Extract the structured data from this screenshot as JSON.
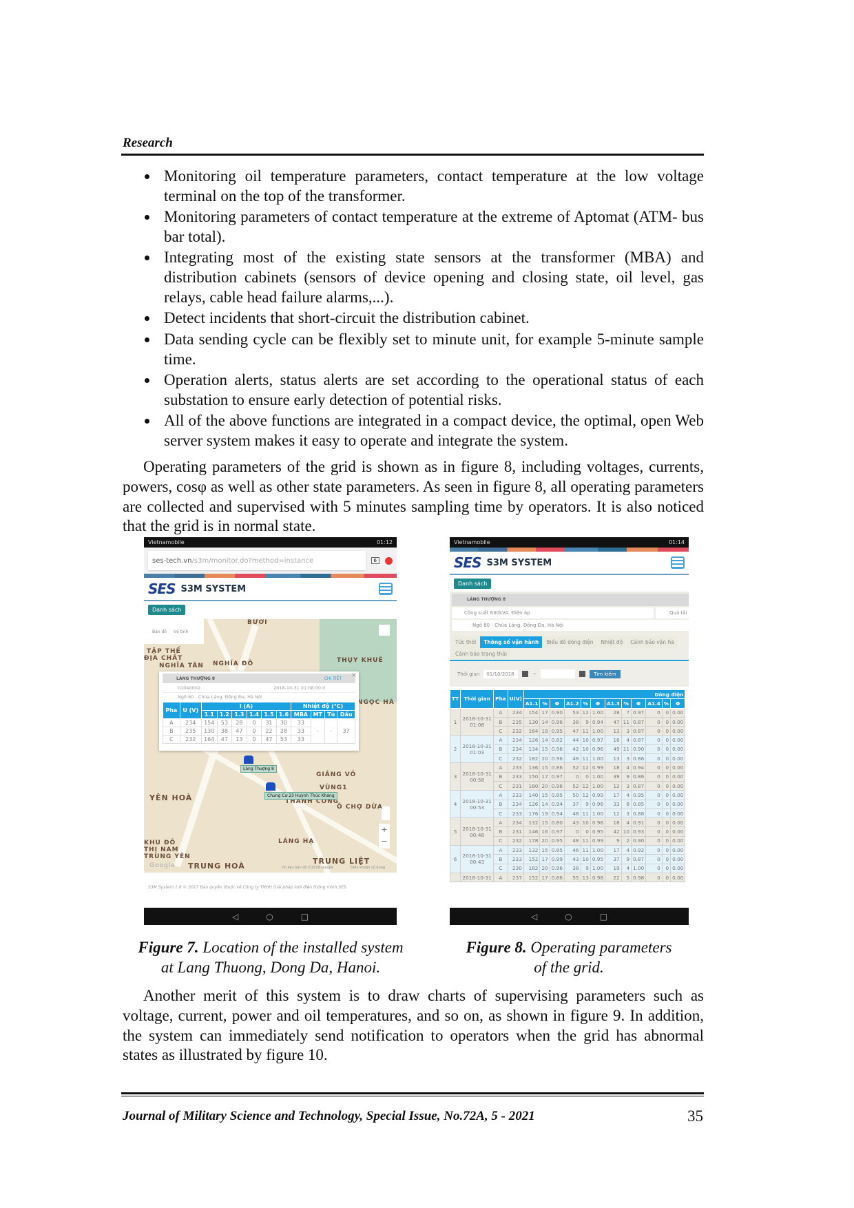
{
  "header": {
    "section": "Research"
  },
  "bullets": [
    "Monitoring oil temperature parameters, contact temperature at the low voltage terminal on the top of the transformer.",
    "Monitoring parameters of contact temperature at the extreme of Aptomat (ATM- bus bar total).",
    "Integrating most of the existing state sensors at the transformer (MBA) and distribution cabinets (sensors of device opening and closing state, oil level, gas relays, cable head failure alarms,...).",
    "Detect incidents that short-circuit the distribution cabinet.",
    "Data sending cycle can be flexibly set to minute unit, for example 5-minute sample time.",
    "Operation alerts, status alerts are set according to the operational status of each substation to ensure early detection of potential risks.",
    "All of the above functions are integrated in a compact device, the optimal, open Web server system makes it easy to operate and integrate the system."
  ],
  "para1": "Operating parameters of the grid is shown as in figure 8, including voltages, currents, powers, cosφ as well as other state parameters. As seen in figure 8, all operating parameters are collected and supervised with 5 minutes sampling time by operators. It is also noticed that the grid is in normal state.",
  "fig7": {
    "carrier": "Vietnamobile",
    "time": "01:12",
    "url_host": "ses-tech.vn",
    "url_path": "/s3m/monitor.do?method=instance",
    "tab_count": "6",
    "logo": "SES",
    "system": "S3M SYSTEM",
    "list_button": "Danh sách",
    "map_type": [
      "Bản đồ",
      "Vệ tinh"
    ],
    "map_labels": [
      "BƯỞI",
      "TẬP THỂ",
      "ĐỊA CHẤT",
      "NGHĨA TÂN",
      "NGHĨA ĐÔ",
      "THỤY KHUÊ",
      "NGỌC HÀ",
      "GIẢNG VÕ",
      "VÙNG1",
      "YÊN HOÀ",
      "THÀNH CÔNG",
      "Ô CHỢ DỪA",
      "LÁNG HẠ",
      "KHU ĐÔ",
      "THỊ NAM",
      "TRUNG YÊN",
      "TRUNG HOÀ",
      "TRUNG LIỆT",
      "Google",
      "Dữ liệu bản đồ ©2018 Google",
      "Điều khoản sử dụng"
    ],
    "markers": [
      "Láng Thượng 8",
      "Chung Cư 23 Huỳnh Thúc Kháng"
    ],
    "popup": {
      "station": "LÁNG THƯỢNG 8",
      "detail": "CHI TIẾT",
      "close": "×",
      "id": "01040002",
      "timestamp": "2018-10-31 01:08:00.0",
      "address": "Ngõ 80 - Chùa Láng, Đống Đa, Hà Nội",
      "headers": {
        "phase": "Pha",
        "voltage": "U (V)",
        "current": "I (A)",
        "temp": "Nhiệt độ (°C)"
      },
      "current_cols": [
        "1.1",
        "1.2",
        "1.3",
        "1.4",
        "1.5",
        "1.6"
      ],
      "temp_cols": [
        "MBA",
        "MT",
        "Tủ",
        "Dầu"
      ],
      "rows": [
        {
          "pha": "A",
          "u": "234",
          "i": [
            "154",
            "53",
            "28",
            "0",
            "31",
            "30"
          ],
          "mba": "33"
        },
        {
          "pha": "B",
          "u": "235",
          "i": [
            "130",
            "38",
            "47",
            "0",
            "22",
            "28"
          ],
          "mba": "33"
        },
        {
          "pha": "C",
          "u": "232",
          "i": [
            "164",
            "47",
            "13",
            "0",
            "47",
            "53"
          ],
          "mba": "33"
        }
      ],
      "mt": "-",
      "tu": "-",
      "dau": "37"
    },
    "copyright": "S3M System 1.0 © 2017 Bản quyền thuộc về Công ty TNHH Giải pháp lưới điện thông minh SES."
  },
  "fig8": {
    "carrier": "Vietnamobile",
    "time": "01:14",
    "logo": "SES",
    "system": "S3M SYSTEM",
    "list_button": "Danh sách",
    "station": "LÁNG THƯỢNG 8",
    "capacity": "Công suất 630kVA. Điện áp",
    "alert": "Quá tải",
    "address": "Ngõ 80 - Chùa Láng, Đống Đa, Hà Nội",
    "tabs": [
      "Tức thời",
      "Thông số vận hành",
      "Biểu đồ dòng điện",
      "Nhiệt độ",
      "Cảnh báo vận hà",
      "Cảnh báo trạng thái"
    ],
    "active_tab": 1,
    "time_label": "Thời gian",
    "date_from": "01/10/2018",
    "search": "Tìm kiếm",
    "headers": [
      "TT",
      "Thời gian",
      "Pha",
      "U(V)"
    ],
    "group_header": "Dòng điện",
    "sub_headers": [
      "A1.1",
      "%",
      "Φ",
      "A1.2",
      "%",
      "Φ",
      "A1.3",
      "%",
      "Φ",
      "A1.4",
      "%",
      "Φ"
    ],
    "groups": [
      {
        "tt": "1",
        "time": "2018-10-31 01:08",
        "rows": [
          [
            "A",
            "234",
            "154",
            "17",
            "0.90",
            "53",
            "12",
            "1.00",
            "28",
            "7",
            "0.97",
            "0",
            "0",
            "0.00"
          ],
          [
            "B",
            "235",
            "130",
            "14",
            "0.96",
            "38",
            "9",
            "0.94",
            "47",
            "11",
            "0.87",
            "0",
            "0",
            "0.00"
          ],
          [
            "C",
            "232",
            "164",
            "18",
            "0.95",
            "47",
            "11",
            "1.00",
            "13",
            "3",
            "0.87",
            "0",
            "0",
            "0.00"
          ]
        ]
      },
      {
        "tt": "2",
        "time": "2018-10-31 01:03",
        "rows": [
          [
            "A",
            "234",
            "126",
            "14",
            "0.82",
            "44",
            "10",
            "0.97",
            "16",
            "4",
            "0.87",
            "0",
            "0",
            "0.00"
          ],
          [
            "B",
            "234",
            "134",
            "15",
            "0.96",
            "42",
            "10",
            "0.96",
            "49",
            "11",
            "0.90",
            "0",
            "0",
            "0.00"
          ],
          [
            "C",
            "232",
            "182",
            "20",
            "0.96",
            "48",
            "11",
            "1.00",
            "13",
            "3",
            "0.86",
            "0",
            "0",
            "0.00"
          ]
        ]
      },
      {
        "tt": "3",
        "time": "2018-10-31 00:58",
        "rows": [
          [
            "A",
            "233",
            "136",
            "15",
            "0.86",
            "52",
            "12",
            "0.99",
            "18",
            "4",
            "0.94",
            "0",
            "0",
            "0.00"
          ],
          [
            "B",
            "233",
            "150",
            "17",
            "0.97",
            "0",
            "0",
            "1.00",
            "39",
            "9",
            "0.86",
            "0",
            "0",
            "0.00"
          ],
          [
            "C",
            "231",
            "180",
            "20",
            "0.96",
            "52",
            "12",
            "1.00",
            "12",
            "3",
            "0.87",
            "0",
            "0",
            "0.00"
          ]
        ]
      },
      {
        "tt": "4",
        "time": "2018-10-31 00:53",
        "rows": [
          [
            "A",
            "233",
            "140",
            "15",
            "0.85",
            "50",
            "12",
            "0.99",
            "17",
            "4",
            "0.95",
            "0",
            "0",
            "0.00"
          ],
          [
            "B",
            "234",
            "126",
            "14",
            "0.94",
            "37",
            "9",
            "0.96",
            "33",
            "8",
            "0.85",
            "0",
            "0",
            "0.00"
          ],
          [
            "C",
            "233",
            "176",
            "19",
            "0.94",
            "48",
            "11",
            "1.00",
            "12",
            "3",
            "0.88",
            "0",
            "0",
            "0.00"
          ]
        ]
      },
      {
        "tt": "5",
        "time": "2018-10-31 00:48",
        "rows": [
          [
            "A",
            "234",
            "132",
            "15",
            "0.80",
            "43",
            "10",
            "0.96",
            "18",
            "4",
            "0.91",
            "0",
            "0",
            "0.00"
          ],
          [
            "B",
            "231",
            "146",
            "16",
            "0.97",
            "0",
            "0",
            "0.95",
            "42",
            "10",
            "0.93",
            "0",
            "0",
            "0.00"
          ],
          [
            "C",
            "232",
            "178",
            "20",
            "0.95",
            "48",
            "11",
            "0.99",
            "9",
            "2",
            "0.90",
            "0",
            "0",
            "0.00"
          ]
        ]
      },
      {
        "tt": "6",
        "time": "2018-10-31 00:43",
        "rows": [
          [
            "A",
            "233",
            "132",
            "15",
            "0.85",
            "46",
            "11",
            "1.00",
            "17",
            "4",
            "0.92",
            "0",
            "0",
            "0.00"
          ],
          [
            "B",
            "233",
            "152",
            "17",
            "0.99",
            "43",
            "10",
            "0.95",
            "37",
            "9",
            "0.87",
            "0",
            "0",
            "0.00"
          ],
          [
            "C",
            "230",
            "182",
            "20",
            "0.96",
            "38",
            "9",
            "1.00",
            "19",
            "4",
            "1.00",
            "0",
            "0",
            "0.00"
          ]
        ]
      },
      {
        "tt": "",
        "time": "2018-10-31",
        "rows": [
          [
            "A",
            "237",
            "152",
            "17",
            "0.86",
            "55",
            "13",
            "0.98",
            "22",
            "5",
            "0.98",
            "0",
            "0",
            "0.00"
          ]
        ]
      }
    ]
  },
  "captions": {
    "fig7_label": "Figure 7.",
    "fig7_text": " Location of the installed system",
    "fig7_text2": "at Lang Thuong, Dong Da, Hanoi.",
    "fig8_label": "Figure 8.",
    "fig8_text": " Operating parameters",
    "fig8_text2": "of the grid."
  },
  "para2": "Another merit of this system is to draw charts of supervising parameters such as voltage, current, power and oil temperatures, and so on, as shown in figure 9. In addition, the system can immediately send notification to operators when the grid has abnormal states as illustrated by figure 10.",
  "footer": {
    "journal": "Journal of Military Science and Technology, Special Issue, No.72A, 5 - 2021",
    "page": "35"
  },
  "colors": {
    "table_header": "#1ba0e0",
    "list_button": "#1e8a8e",
    "logo": "#1d3f8f"
  }
}
